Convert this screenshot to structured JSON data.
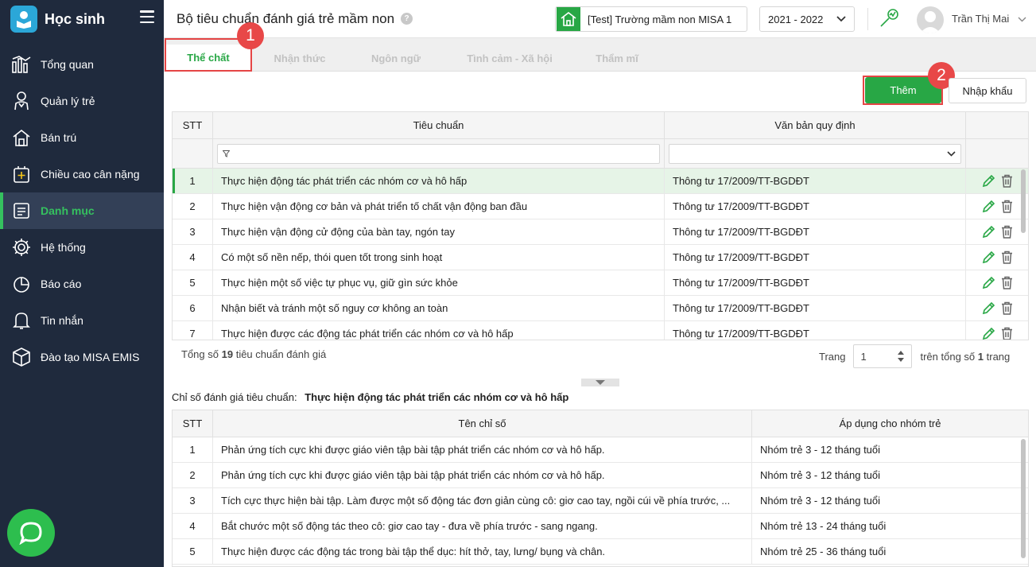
{
  "app": {
    "name": "Học sinh"
  },
  "sidebar": {
    "items": [
      {
        "label": "Tổng quan",
        "icon": "chart-icon"
      },
      {
        "label": "Quản lý trẻ",
        "icon": "child-icon"
      },
      {
        "label": "Bán trú",
        "icon": "house-icon"
      },
      {
        "label": "Chiều cao cân nặng",
        "icon": "plus-box-icon"
      },
      {
        "label": "Danh mục",
        "icon": "list-icon",
        "active": true
      },
      {
        "label": "Hệ thống",
        "icon": "gear-icon"
      },
      {
        "label": "Báo cáo",
        "icon": "pie-icon"
      },
      {
        "label": "Tin nhắn",
        "icon": "bell-icon"
      },
      {
        "label": "Đào tạo MISA EMIS",
        "icon": "cube-icon"
      }
    ]
  },
  "header": {
    "title": "Bộ tiêu chuẩn đánh giá trẻ mầm non",
    "help": "?",
    "school": "[Test] Trường mầm non MISA 1",
    "year": "2021 - 2022",
    "user": "Trần Thị Mai"
  },
  "tabs": [
    "Thể chất",
    "Nhận thức",
    "Ngôn ngữ",
    "Tình cảm - Xã hội",
    "Thẩm mĩ"
  ],
  "badges": {
    "one": "1",
    "two": "2"
  },
  "toolbar": {
    "add_label": "Thêm",
    "import_label": "Nhập khẩu"
  },
  "standards": {
    "columns": {
      "stt": "STT",
      "name": "Tiêu chuẩn",
      "doc": "Văn bản quy định"
    },
    "rows": [
      {
        "stt": "1",
        "name": "Thực hiện động tác phát triển các nhóm cơ và hô hấp",
        "doc": "Thông tư 17/2009/TT-BGDĐT"
      },
      {
        "stt": "2",
        "name": "Thực hiện vận động cơ bản và phát triển tố chất vận động ban đầu",
        "doc": "Thông tư 17/2009/TT-BGDĐT"
      },
      {
        "stt": "3",
        "name": "Thực hiện vận động cử động của bàn tay, ngón tay",
        "doc": "Thông tư 17/2009/TT-BGDĐT"
      },
      {
        "stt": "4",
        "name": "Có một số nền nếp, thói quen tốt trong sinh hoạt",
        "doc": "Thông tư 17/2009/TT-BGDĐT"
      },
      {
        "stt": "5",
        "name": "Thực hiện một số việc tự phục vụ, giữ gìn sức khỏe",
        "doc": "Thông tư 17/2009/TT-BGDĐT"
      },
      {
        "stt": "6",
        "name": "Nhận biết và tránh một số nguy cơ không an toàn",
        "doc": "Thông tư 17/2009/TT-BGDĐT"
      },
      {
        "stt": "7",
        "name": "Thực hiện được các động tác phát triển các nhóm cơ và hô hấp",
        "doc": "Thông tư 17/2009/TT-BGDĐT"
      }
    ],
    "total_prefix": "Tổng số",
    "total": "19",
    "total_suffix": "tiêu chuẩn đánh giá"
  },
  "pager": {
    "label": "Trang",
    "page": "1",
    "of_prefix": "trên tổng số",
    "total_pages": "1",
    "of_suffix": "trang"
  },
  "indicators": {
    "label": "Chỉ số đánh giá tiêu chuẩn:",
    "standard": "Thực hiện động tác phát triển các nhóm cơ và hô hấp",
    "columns": {
      "stt": "STT",
      "name": "Tên chỉ số",
      "group": "Áp dụng cho nhóm trẻ"
    },
    "rows": [
      {
        "stt": "1",
        "name": "Phản ứng tích cực khi được giáo viên tập bài tập phát triển các nhóm cơ và hô hấp.",
        "group": "Nhóm trẻ 3 - 12 tháng tuổi"
      },
      {
        "stt": "2",
        "name": "Phản ứng tích cực khi được giáo viên tập bài tập phát triển các nhóm cơ và hô hấp.",
        "group": "Nhóm trẻ 3 - 12 tháng tuổi"
      },
      {
        "stt": "3",
        "name": "Tích cực thực hiện bài tập. Làm được một số động tác đơn giản cùng cô: giơ cao tay, ngồi cúi về phía trước, ...",
        "group": "Nhóm trẻ 3 - 12 tháng tuổi"
      },
      {
        "stt": "4",
        "name": "Bắt chước một số động tác theo cô: giơ cao tay - đưa về phía trước - sang ngang.",
        "group": "Nhóm trẻ 13 - 24 tháng tuổi"
      },
      {
        "stt": "5",
        "name": "Thực hiện được các động tác trong bài tập thể dục: hít thở, tay, lưng/ bụng và chân.",
        "group": "Nhóm trẻ 25 - 36 tháng tuổi"
      }
    ]
  },
  "colors": {
    "sidebar": "#1f2a3d",
    "accent": "#28a745",
    "highlight": "#e54545"
  }
}
